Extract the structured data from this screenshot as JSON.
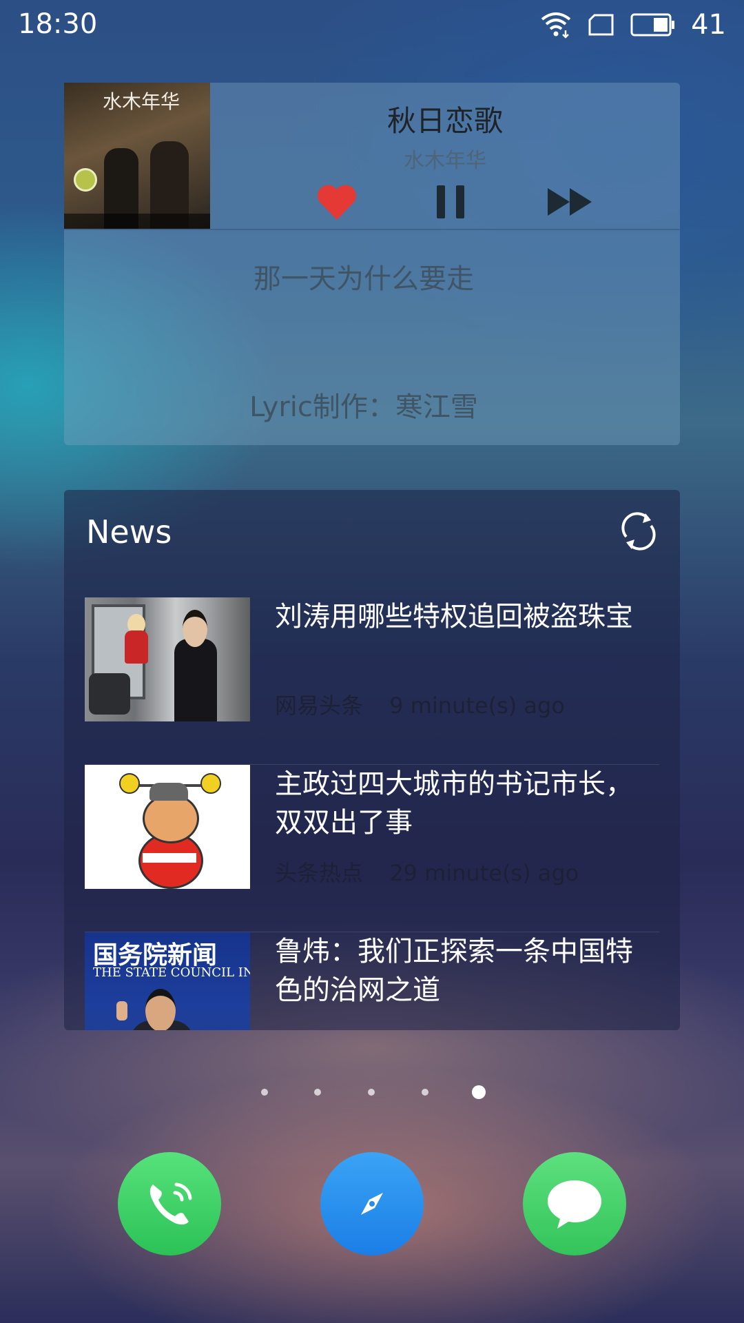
{
  "status_bar": {
    "time": "18:30",
    "battery_level": "41",
    "icons": [
      "wifi-icon",
      "sim-card-icon",
      "battery-icon"
    ]
  },
  "music_widget": {
    "album_art_text": "水木年华",
    "song_title": "秋日恋歌",
    "artist": "水木年华",
    "favorite_color": "#e53935",
    "lyrics": [
      "那一天为什么要走",
      "Lyric制作：寒江雪"
    ],
    "controls": [
      "heart-icon",
      "pause-icon",
      "fast-forward-icon"
    ]
  },
  "news_widget": {
    "title": "News",
    "items": [
      {
        "headline": "刘涛用哪些特权追回被盗珠宝",
        "source": "网易头条",
        "time_ago": "9 minute(s) ago"
      },
      {
        "headline": "主政过四大城市的书记市长，双双出了事",
        "source": "头条热点",
        "time_ago": "29 minute(s) ago"
      },
      {
        "headline": "鲁炜：我们正探索一条中国特色的治网之道",
        "thumb_banner_cn": "国务院新闻",
        "thumb_banner_en": "THE STATE COUNCIL INFO"
      }
    ]
  },
  "pager": {
    "total_pages": 5,
    "active_page": 5
  },
  "dock": {
    "apps": [
      "phone-icon",
      "browser-compass-icon",
      "messages-icon"
    ]
  }
}
